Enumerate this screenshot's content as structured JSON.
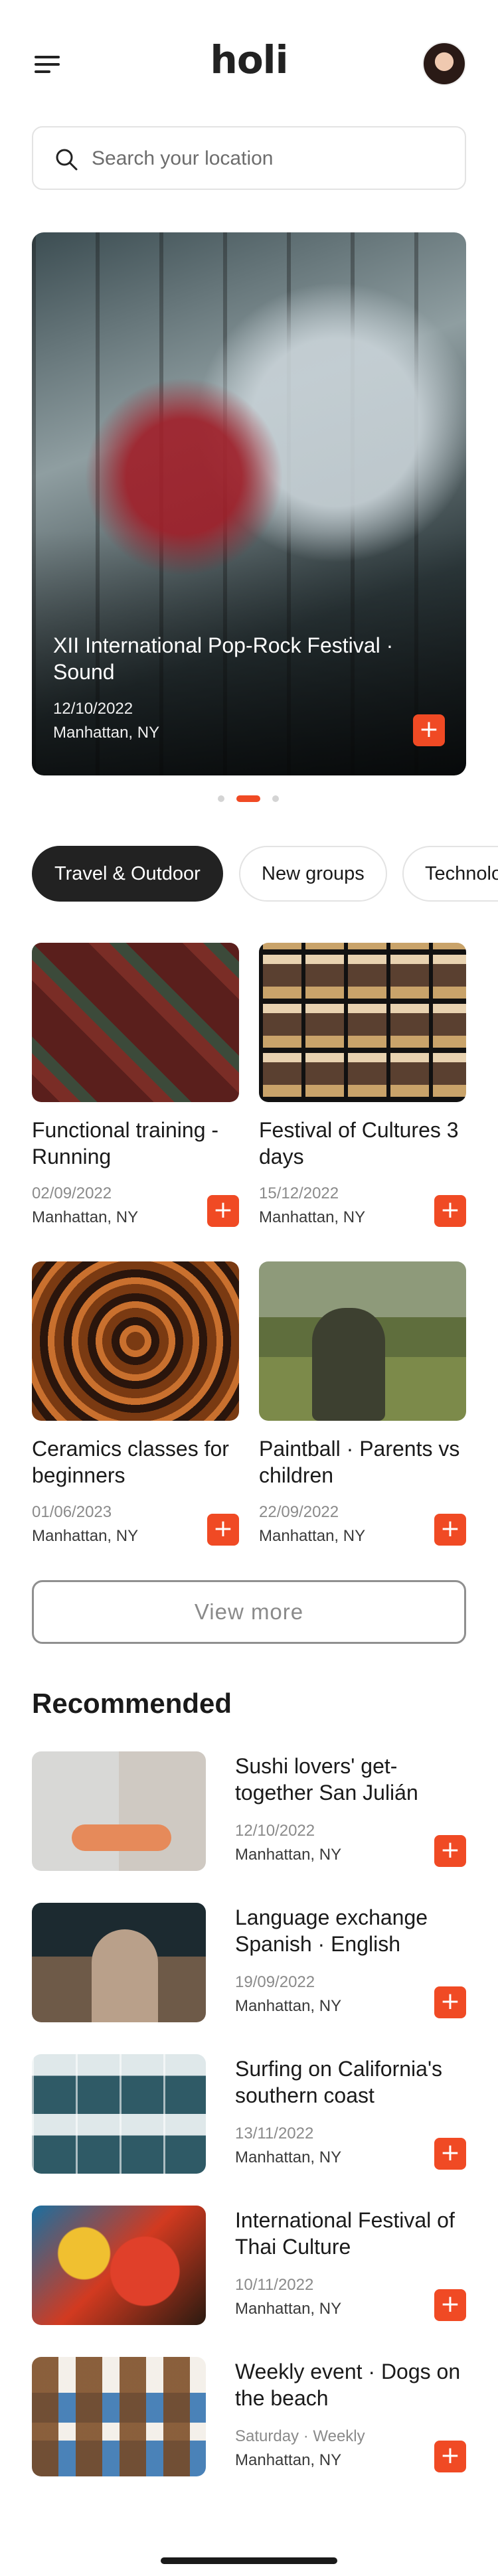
{
  "header": {
    "logo_text": "holi",
    "menu_icon": "menu-icon",
    "avatar": "user-avatar"
  },
  "search": {
    "placeholder": "Search your location",
    "icon": "search-icon"
  },
  "hero": {
    "title": "XII International Pop-Rock Festival · Sound",
    "date": "12/10/2022",
    "location": "Manhattan, NY",
    "add_label": "+"
  },
  "carousel": {
    "count": 3,
    "active_index": 1
  },
  "categories": [
    {
      "label": "Travel & Outdoor",
      "active": true
    },
    {
      "label": "New groups",
      "active": false
    },
    {
      "label": "Technology",
      "active": false
    }
  ],
  "events": [
    {
      "title": "Functional training - Running",
      "date": "02/09/2022",
      "location": "Manhattan, NY",
      "add_label": "+"
    },
    {
      "title": "Festival of Cultures 3 days",
      "date": "15/12/2022",
      "location": "Manhattan, NY",
      "add_label": "+"
    },
    {
      "title": "Ceramics classes for beginners",
      "date": "01/06/2023",
      "location": "Manhattan, NY",
      "add_label": "+"
    },
    {
      "title": "Paintball · Parents vs children",
      "date": "22/09/2022",
      "location": "Manhattan, NY",
      "add_label": "+"
    }
  ],
  "view_more_label": "View more",
  "recommended": {
    "title": "Recommended",
    "items": [
      {
        "title": "Sushi lovers' get-together San Julián",
        "date": "12/10/2022",
        "location": "Manhattan, NY",
        "add_label": "+"
      },
      {
        "title": "Language exchange Spanish · English",
        "date": "19/09/2022",
        "location": "Manhattan, NY",
        "add_label": "+"
      },
      {
        "title": "Surfing on California's southern coast",
        "date": "13/11/2022",
        "location": "Manhattan, NY",
        "add_label": "+"
      },
      {
        "title": "International Festival of Thai Culture",
        "date": "10/11/2022",
        "location": "Manhattan, NY",
        "add_label": "+"
      },
      {
        "title": "Weekly event · Dogs on the beach",
        "date": "Saturday · Weekly",
        "location": "Manhattan, NY",
        "add_label": "+"
      }
    ]
  },
  "colors": {
    "accent": "#f04a24",
    "chip_active": "#222222",
    "text": "#1a1a1a",
    "muted": "#8a8a8a"
  }
}
